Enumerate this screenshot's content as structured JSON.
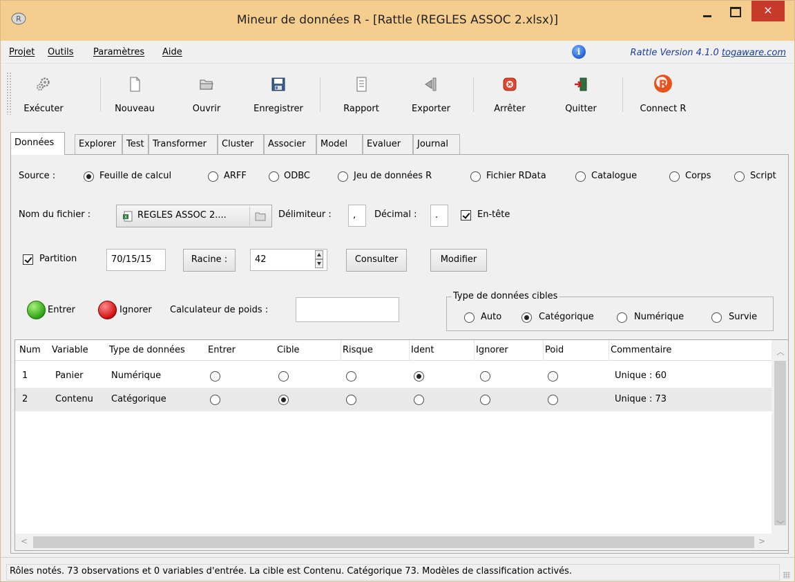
{
  "window": {
    "title": "Mineur de données R - [Rattle (REGLES ASSOC 2.xlsx)]",
    "close_label": "×"
  },
  "menu": {
    "items": [
      "Projet",
      "Outils",
      "Paramètres",
      "Aide"
    ],
    "info_glyph": "i",
    "version_text": "Rattle Version 4.1.0 ",
    "version_link": "togaware.com"
  },
  "toolbar": {
    "buttons": [
      "Exécuter",
      "Nouveau",
      "Ouvrir",
      "Enregistrer",
      "Rapport",
      "Exporter",
      "Arrêter",
      "Quitter",
      "Connect R"
    ]
  },
  "tabs": [
    "Données",
    "Explorer",
    "Test",
    "Transformer",
    "Cluster",
    "Associer",
    "Model",
    "Evaluer",
    "Journal"
  ],
  "source": {
    "label": "Source :",
    "options": [
      "Feuille de calcul",
      "ARFF",
      "ODBC",
      "Jeu de données R",
      "Fichier RData",
      "Catalogue",
      "Corps",
      "Script"
    ],
    "selected": "Feuille de calcul"
  },
  "file": {
    "label": "Nom du fichier :",
    "value": "REGLES ASSOC 2....",
    "delim_label": "Délimiteur :",
    "delim_value": ",",
    "decimal_label": "Décimal :",
    "decimal_value": ".",
    "header_label": "En-tête",
    "header_checked": true
  },
  "partition": {
    "label": "Partition",
    "checked": true,
    "value": "70/15/15",
    "seed_button": "Racine :",
    "seed_value": "42",
    "view_button": "Consulter",
    "edit_button": "Modifier"
  },
  "roles": {
    "input_label": "Entrer",
    "ignore_label": "Ignorer",
    "weight_label": "Calculateur de poids :",
    "weight_value": ""
  },
  "target_type": {
    "legend": "Type de données cibles",
    "options": [
      "Auto",
      "Catégorique",
      "Numérique",
      "Survie"
    ],
    "selected": "Catégorique"
  },
  "table": {
    "headers": [
      "Num",
      "Variable",
      "Type de données",
      "Entrer",
      "Cible",
      "Risque",
      "Ident",
      "Ignorer",
      "Poid",
      "Commentaire"
    ],
    "rows": [
      {
        "num": "1",
        "variable": "Panier",
        "type": "Numérique",
        "role": "Ident",
        "comment": "Unique : 60"
      },
      {
        "num": "2",
        "variable": "Contenu",
        "type": "Catégorique",
        "role": "Cible",
        "comment": "Unique : 73"
      }
    ]
  },
  "status": {
    "text": "Rôles notés. 73 observations et 0 variables d'entrée. La cible est Contenu. Catégorique 73. Modèles de classification activés."
  },
  "colors": {
    "titlebar": "#f4cd8f",
    "close": "#c7392b",
    "link": "#1a3d9a"
  }
}
